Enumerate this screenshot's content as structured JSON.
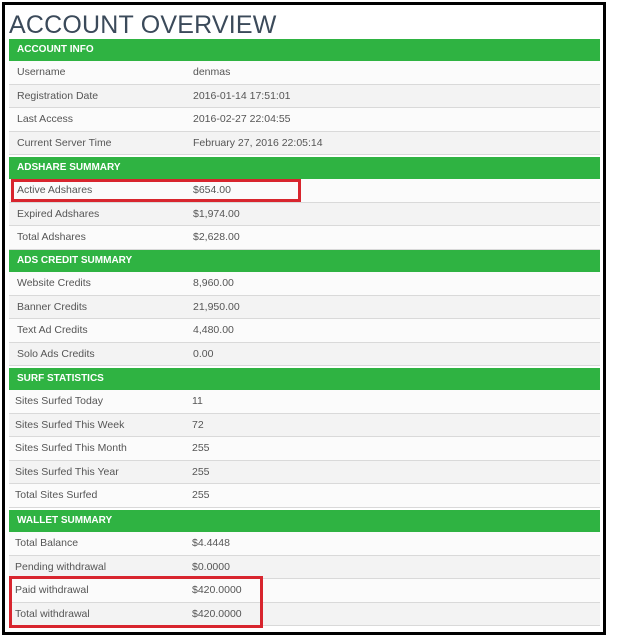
{
  "page_title": "ACCOUNT OVERVIEW",
  "highlight_color": "#d8252e",
  "header_color": "#2fb342",
  "sections": [
    {
      "heading": "ACCOUNT INFO",
      "rows": [
        {
          "label": "Username",
          "value": "denmas"
        },
        {
          "label": "Registration Date",
          "value": "2016-01-14 17:51:01"
        },
        {
          "label": "Last Access",
          "value": "2016-02-27 22:04:55"
        },
        {
          "label": "Current Server Time",
          "value": "February 27, 2016 22:05:14"
        }
      ]
    },
    {
      "heading": "ADSHARE SUMMARY",
      "rows": [
        {
          "label": "Active Adshares",
          "value": "$654.00"
        },
        {
          "label": "Expired Adshares",
          "value": "$1,974.00"
        },
        {
          "label": "Total Adshares",
          "value": "$2,628.00"
        }
      ]
    },
    {
      "heading": "ADS CREDIT SUMMARY",
      "rows": [
        {
          "label": "Website Credits",
          "value": "8,960.00"
        },
        {
          "label": "Banner Credits",
          "value": "21,950.00"
        },
        {
          "label": "Text Ad Credits",
          "value": "4,480.00"
        },
        {
          "label": "Solo Ads Credits",
          "value": "0.00"
        }
      ]
    },
    {
      "heading": "SURF STATISTICS",
      "rows": [
        {
          "label": "Sites Surfed Today",
          "value": "11"
        },
        {
          "label": "Sites Surfed This Week",
          "value": "72"
        },
        {
          "label": "Sites Surfed This Month",
          "value": "255"
        },
        {
          "label": "Sites Surfed This Year",
          "value": "255"
        },
        {
          "label": "Total Sites Surfed",
          "value": "255"
        }
      ]
    },
    {
      "heading": "WALLET SUMMARY",
      "rows": [
        {
          "label": "Total Balance",
          "value": "$4.4448"
        },
        {
          "label": "Pending withdrawal",
          "value": "$0.0000"
        },
        {
          "label": "Paid withdrawal",
          "value": "$420.0000"
        },
        {
          "label": "Total withdrawal",
          "value": "$420.0000"
        }
      ]
    }
  ]
}
